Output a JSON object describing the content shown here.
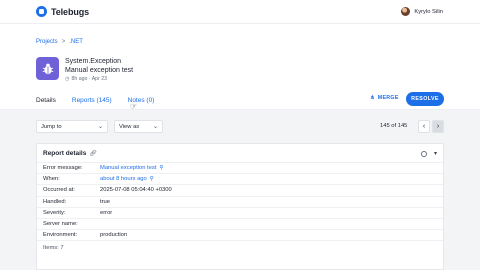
{
  "app": {
    "name": "Telebugs",
    "brand_color": "#1d6fe8"
  },
  "user": {
    "name": "Kyrylo Silin"
  },
  "breadcrumb": {
    "items": [
      "Projects",
      ".NET"
    ],
    "separator": ">"
  },
  "error": {
    "type": "System.Exception",
    "message": "Manual exception test",
    "meta": "8h ago · Apr 23",
    "icon": "bug-icon",
    "icon_color": "#6f62d8"
  },
  "tabs": [
    {
      "label": "Details",
      "active": true
    },
    {
      "label": "Reports (145)",
      "active": false
    },
    {
      "label": "Notes (0)",
      "active": false
    }
  ],
  "actions": {
    "merge": "MERGE",
    "resolve": "RESOLVE"
  },
  "toolbar": {
    "jump_to": "Jump to",
    "view_as": "View as",
    "pager": "145 of 145"
  },
  "report": {
    "title": "Report details",
    "rows": [
      {
        "label": "Error message:",
        "value": "Manual exception test",
        "link": true
      },
      {
        "label": "When:",
        "value": "about 8 hours ago",
        "link": true
      },
      {
        "label": "Occurred at:",
        "value": "2025-07-08 05:04:40 +0300",
        "link": false
      },
      {
        "label": "Handled:",
        "value": "true",
        "link": false
      },
      {
        "label": "Severity:",
        "value": "error",
        "link": false
      },
      {
        "label": "Server name:",
        "value": "",
        "link": false
      },
      {
        "label": "Environment:",
        "value": "production",
        "link": false
      }
    ],
    "items": "Items: 7"
  }
}
